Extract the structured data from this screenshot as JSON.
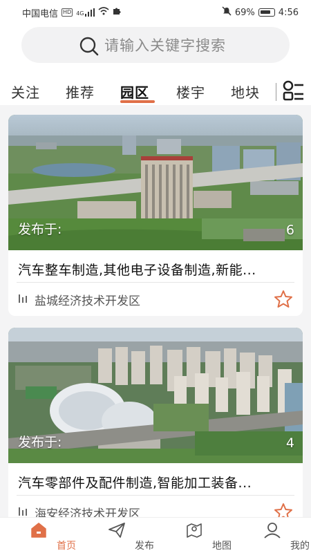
{
  "status": {
    "carrier": "中国电信",
    "hd": "HD",
    "signal": "4G",
    "battery": "69%",
    "time": "4:56"
  },
  "search": {
    "placeholder": "请输入关键字搜索"
  },
  "tabs": [
    {
      "label": "关注",
      "active": false
    },
    {
      "label": "推荐",
      "active": false
    },
    {
      "label": "园区",
      "active": true
    },
    {
      "label": "楼宇",
      "active": false
    },
    {
      "label": "地块",
      "active": false
    }
  ],
  "cards": [
    {
      "published": "发布于:",
      "count": "6",
      "title": "汽车整车制造,其他电子设备制造,新能...",
      "location": "盐城经济技术开发区"
    },
    {
      "published": "发布于:",
      "count": "4",
      "title": "汽车零部件及配件制造,智能加工装备...",
      "location": "海安经济技术开发区"
    }
  ],
  "nav": [
    {
      "label": "首页",
      "icon": "home-icon",
      "active": true
    },
    {
      "label": "发布",
      "icon": "send-icon",
      "active": false
    },
    {
      "label": "地图",
      "icon": "map-pin-icon",
      "active": false
    },
    {
      "label": "我的",
      "icon": "user-icon",
      "active": false
    }
  ],
  "colors": {
    "accent": "#e07048",
    "searchBg": "#f2f2f3",
    "pageBg": "#f4f4f5"
  }
}
